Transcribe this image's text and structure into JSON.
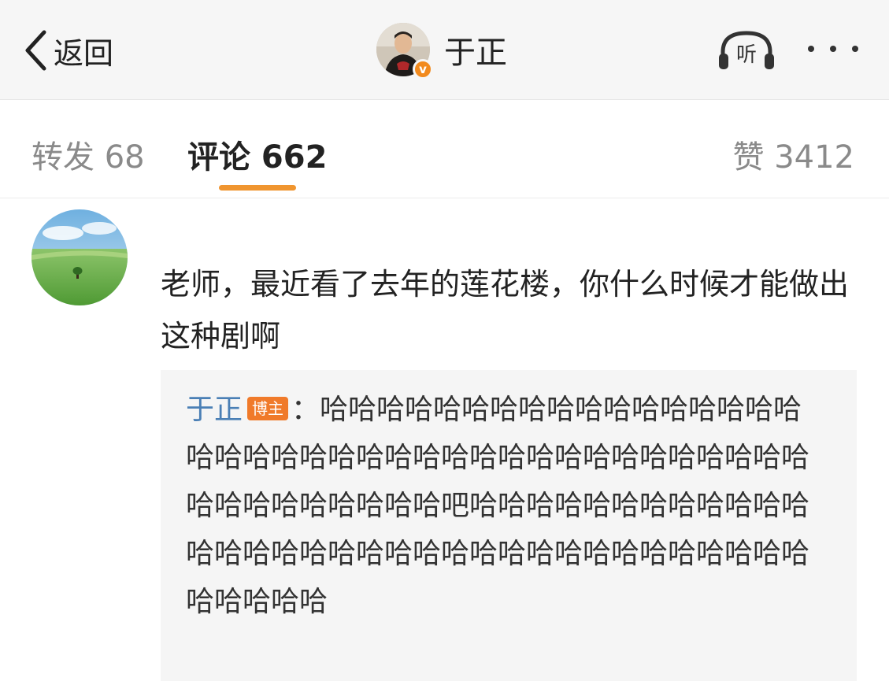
{
  "navbar": {
    "back_label": "返回",
    "profile_name": "于正",
    "verified_badge": "v",
    "listen_label": "听",
    "more_icon": "more-dots-icon",
    "back_icon": "chevron-left-icon"
  },
  "tabs": {
    "repost": "转发 68",
    "comment": "评论 662",
    "like": "赞 3412",
    "active_color": "#f0952f"
  },
  "comment": {
    "text": "老师，最近看了去年的莲花楼，你什么时候才能做出这种剧啊",
    "reply": {
      "author": "于正",
      "badge": "博主",
      "separator": "：",
      "text": "哈哈哈哈哈哈哈哈哈哈哈哈哈哈哈哈哈哈哈哈哈哈哈哈哈哈哈哈哈哈哈哈哈哈哈哈哈哈哈哈哈哈哈哈哈哈哈哈吧哈哈哈哈哈哈哈哈哈哈哈哈哈哈哈哈哈哈哈哈哈哈哈哈哈哈哈哈哈哈哈哈哈哈哈哈哈哈哈"
    }
  },
  "colors": {
    "badge_orange": "#f07a2a",
    "author_blue": "#4a7fb5",
    "verify_orange": "#f28a1d"
  }
}
